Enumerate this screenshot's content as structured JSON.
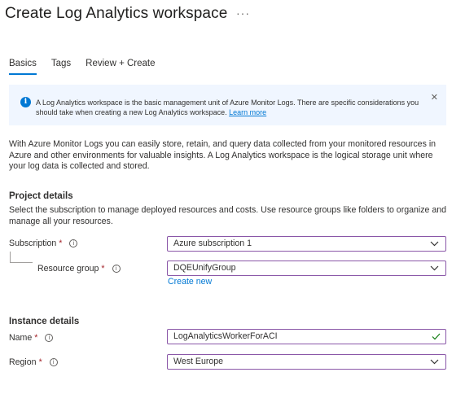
{
  "page": {
    "title": "Create Log Analytics workspace",
    "more": "···"
  },
  "tabs": [
    {
      "label": "Basics",
      "active": true
    },
    {
      "label": "Tags",
      "active": false
    },
    {
      "label": "Review + Create",
      "active": false
    }
  ],
  "info_banner": {
    "icon": "info-icon",
    "text": "A Log Analytics workspace is the basic management unit of Azure Monitor Logs. There are specific considerations you should take when creating a new Log Analytics workspace.",
    "link": "Learn more",
    "close": "✕"
  },
  "description": "With Azure Monitor Logs you can easily store, retain, and query data collected from your monitored resources in Azure and other environments for valuable insights. A Log Analytics workspace is the logical storage unit where your log data is collected and stored.",
  "project_details": {
    "heading": "Project details",
    "subtext": "Select the subscription to manage deployed resources and costs. Use resource groups like folders to organize and manage all your resources.",
    "subscription": {
      "label": "Subscription",
      "required": "*",
      "help": "i",
      "value": "Azure subscription 1"
    },
    "resource_group": {
      "label": "Resource group",
      "required": "*",
      "help": "i",
      "value": "DQEUnifyGroup"
    },
    "create_new": "Create new"
  },
  "instance_details": {
    "heading": "Instance details",
    "name": {
      "label": "Name",
      "required": "*",
      "help": "i",
      "value": "LogAnalyticsWorkerForACI"
    },
    "region": {
      "label": "Region",
      "required": "*",
      "help": "i",
      "value": "West Europe"
    }
  },
  "colors": {
    "accent": "#0078d4",
    "field_border": "#8a57a8",
    "banner_bg": "#f0f6ff",
    "required": "#a4262c",
    "valid_check": "#107c10"
  }
}
